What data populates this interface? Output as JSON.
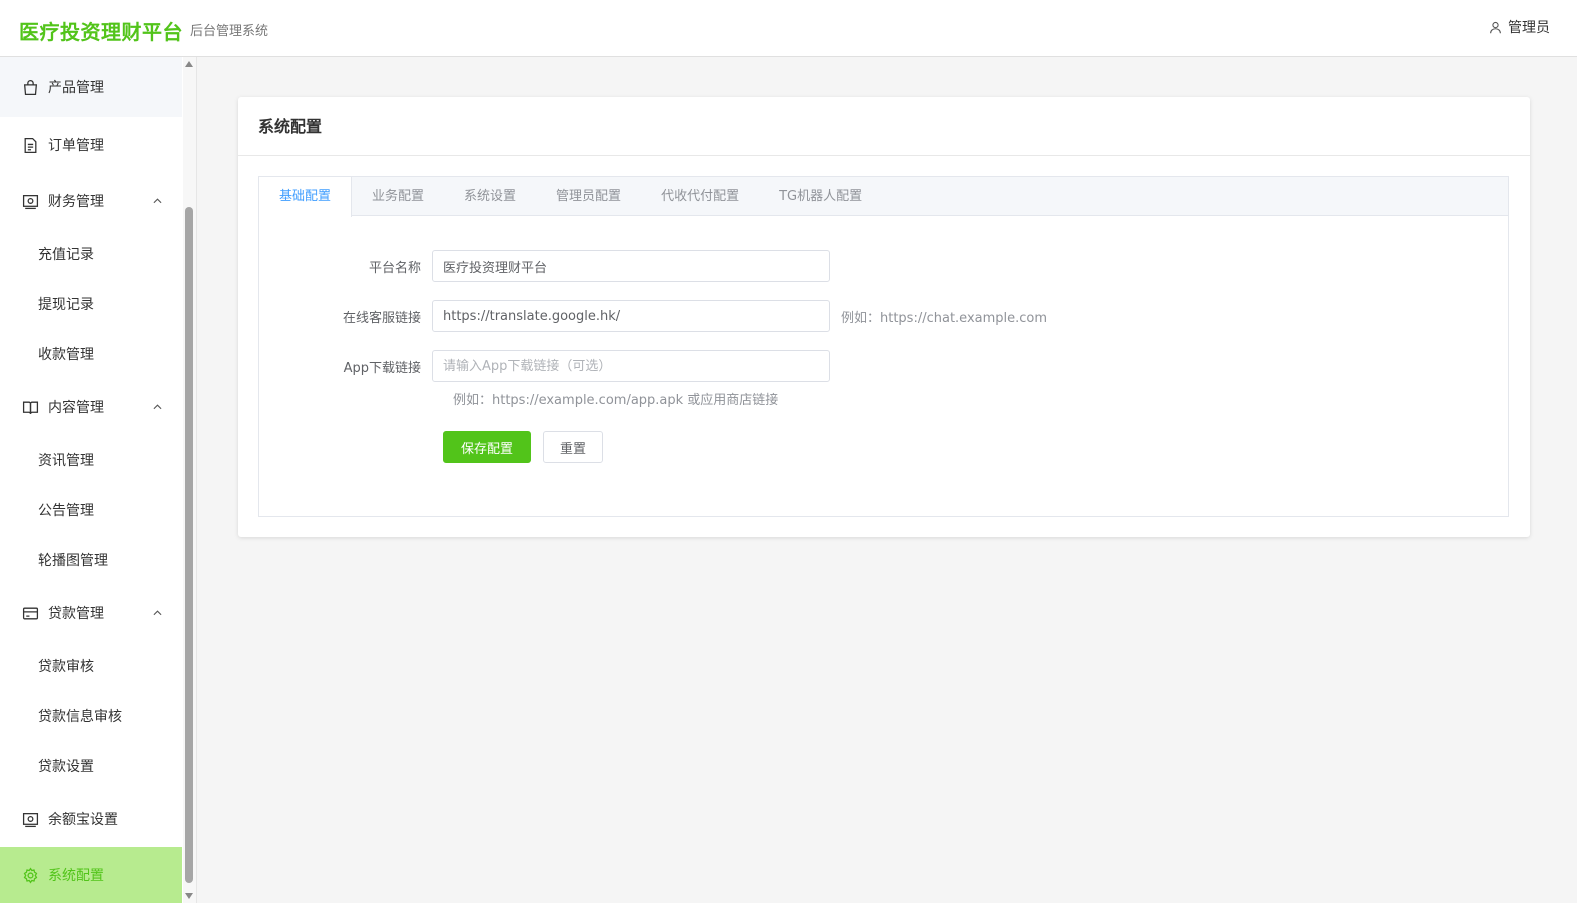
{
  "header": {
    "logo": "医疗投资理财平台",
    "subtitle": "后台管理系统",
    "user": "管理员",
    "brand_color": "#52c41a"
  },
  "sidebar": {
    "items": [
      {
        "label": "产品管理",
        "icon": "bag-icon"
      },
      {
        "label": "订单管理",
        "icon": "document-icon"
      },
      {
        "label": "财务管理",
        "icon": "wallet-icon",
        "expanded": true,
        "children": [
          "充值记录",
          "提现记录",
          "收款管理"
        ]
      },
      {
        "label": "内容管理",
        "icon": "book-icon",
        "expanded": true,
        "children": [
          "资讯管理",
          "公告管理",
          "轮播图管理"
        ]
      },
      {
        "label": "贷款管理",
        "icon": "credit-card-icon",
        "expanded": true,
        "children": [
          "贷款审核",
          "贷款信息审核",
          "贷款设置"
        ]
      },
      {
        "label": "余额宝设置",
        "icon": "wallet-icon"
      },
      {
        "label": "系统配置",
        "icon": "gear-icon",
        "active": true
      }
    ]
  },
  "main": {
    "title": "系统配置",
    "tabs": [
      "基础配置",
      "业务配置",
      "系统设置",
      "管理员配置",
      "代收代付配置",
      "TG机器人配置"
    ],
    "active_tab": 0,
    "form": {
      "platform_name": {
        "label": "平台名称",
        "value": "医疗投资理财平台"
      },
      "service_link": {
        "label": "在线客服链接",
        "value": "https://translate.google.hk/",
        "hint": "例如：https://chat.example.com"
      },
      "app_link": {
        "label": "App下载链接",
        "value": "",
        "placeholder": "请输入App下载链接（可选）",
        "hint": "例如：https://example.com/app.apk 或应用商店链接"
      }
    },
    "buttons": {
      "save": "保存配置",
      "reset": "重置"
    }
  }
}
